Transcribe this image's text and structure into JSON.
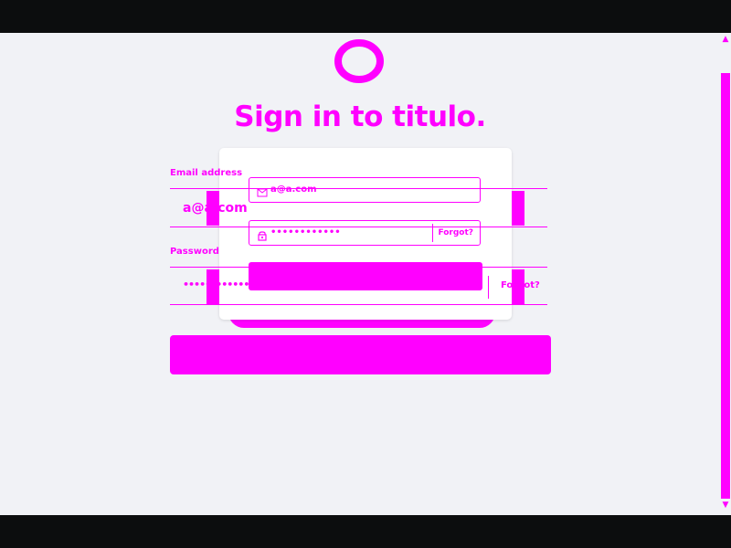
{
  "app": {
    "title": "Sign in to titulo."
  },
  "form": {
    "email_label": "Email address",
    "email_value": "a@a.com",
    "password_label": "Password",
    "password_mask": "••••••••••••",
    "forgot_label": "Forgot?"
  },
  "icons": {
    "logo": "circle-logo-icon",
    "email": "mail-icon",
    "password": "lock-icon",
    "scroll_up": "chevron-up-icon",
    "scroll_down": "chevron-down-icon"
  },
  "colors": {
    "accent": "#ff00ff",
    "page_background": "#f1f2f6",
    "card_background": "#ffffff",
    "outer_frame": "#0c0d0e"
  }
}
